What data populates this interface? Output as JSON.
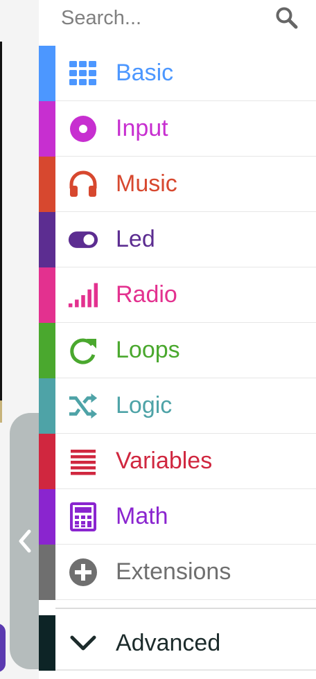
{
  "search": {
    "placeholder": "Search..."
  },
  "categories": [
    {
      "label": "Basic",
      "color": "#4c97ff",
      "icon": "grid-icon"
    },
    {
      "label": "Input",
      "color": "#c72fd0",
      "icon": "record-icon"
    },
    {
      "label": "Music",
      "color": "#d7482f",
      "icon": "headphones-icon"
    },
    {
      "label": "Led",
      "color": "#5c2d91",
      "icon": "toggle-icon"
    },
    {
      "label": "Radio",
      "color": "#e3318f",
      "icon": "signal-bars-icon"
    },
    {
      "label": "Loops",
      "color": "#4aa82e",
      "icon": "refresh-icon"
    },
    {
      "label": "Logic",
      "color": "#4ea3a7",
      "icon": "shuffle-icon"
    },
    {
      "label": "Variables",
      "color": "#d0273f",
      "icon": "list-icon"
    },
    {
      "label": "Math",
      "color": "#8a25cf",
      "icon": "calculator-icon"
    },
    {
      "label": "Extensions",
      "color": "#6f6f6f",
      "icon": "plus-circle-icon"
    }
  ],
  "advanced": {
    "label": "Advanced",
    "color": "#0d2426",
    "icon": "chevron-down-icon"
  },
  "collapse": {
    "icon": "chevron-left-icon"
  }
}
